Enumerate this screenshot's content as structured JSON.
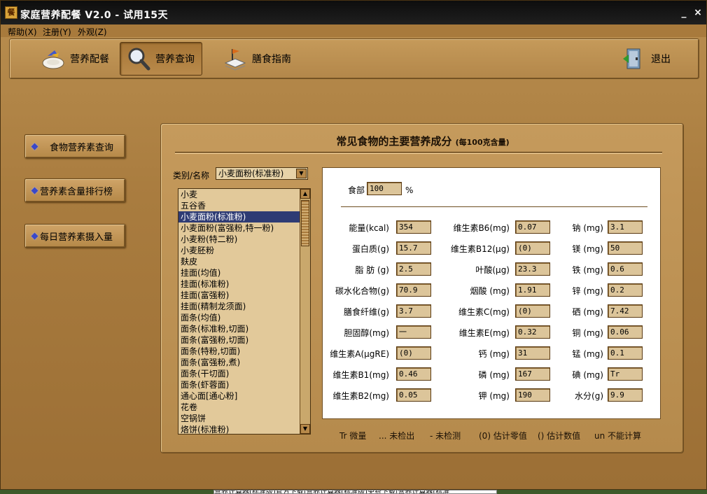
{
  "window": {
    "title": "家庭营养配餐 V2.0 - 试用15天",
    "app_icon": "餐",
    "minimize": "_",
    "close": "×"
  },
  "menu": [
    "帮助(X)",
    "注册(Y)",
    "外观(Z)"
  ],
  "toolbar": {
    "buttons": [
      {
        "label": "营养配餐",
        "icon": "meal-plate-icon"
      },
      {
        "label": "营养查询",
        "icon": "magnifier-icon"
      },
      {
        "label": "膳食指南",
        "icon": "book-flag-icon"
      }
    ],
    "exit": {
      "label": "退出",
      "icon": "exit-door-icon"
    },
    "active_index": 1
  },
  "sidebar": {
    "items": [
      "食物营养素查询",
      "营养素含量排行榜",
      "每日营养素摄入量"
    ]
  },
  "panel": {
    "title": "常见食物的主要营养成分",
    "subtitle": "(每100克含量)"
  },
  "category": {
    "label": "类别/名称",
    "selected": "小麦面粉(标准粉)"
  },
  "food_list": {
    "selected_index": 2,
    "items": [
      "小麦",
      "五谷香",
      "小麦面粉(标准粉)",
      "小麦面粉(富强粉,特一粉)",
      "小麦粉(特二粉)",
      "小麦胚粉",
      "麸皮",
      "挂面(均值)",
      "挂面(标准粉)",
      "挂面(富强粉)",
      "挂面(精制龙须面)",
      "面条(均值)",
      "面条(标准粉,切面)",
      "面条(富强粉,切面)",
      "面条(特粉,切面)",
      "面条(富强粉,煮)",
      "面条(干切面)",
      "面条(虾蓉面)",
      "通心面[通心粉]",
      "花卷",
      "空锅饼",
      "烙饼(标准粉)"
    ]
  },
  "edible": {
    "label": "食部",
    "value": "100",
    "unit": "%"
  },
  "nutrients": {
    "col1": [
      {
        "label": "能量(kcal)",
        "value": "354"
      },
      {
        "label": "蛋白质(g)",
        "value": "15.7"
      },
      {
        "label": "脂 肪 (g)",
        "value": "2.5"
      },
      {
        "label": "碳水化合物(g)",
        "value": "70.9"
      },
      {
        "label": "膳食纤维(g)",
        "value": "3.7"
      },
      {
        "label": "胆固醇(mg)",
        "value": "一"
      },
      {
        "label": "维生素A(μgRE)",
        "value": "(0)"
      },
      {
        "label": "维生素B1(mg)",
        "value": "0.46"
      },
      {
        "label": "维生素B2(mg)",
        "value": "0.05"
      }
    ],
    "col2": [
      {
        "label": "维生素B6(mg)",
        "value": "0.07"
      },
      {
        "label": "维生素B12(μg)",
        "value": "(0)"
      },
      {
        "label": "叶酸(μg)",
        "value": "23.3"
      },
      {
        "label": "烟酸 (mg)",
        "value": "1.91"
      },
      {
        "label": "维生素C(mg)",
        "value": "(0)"
      },
      {
        "label": "维生素E(mg)",
        "value": "0.32"
      },
      {
        "label": "钙 (mg)",
        "value": "31"
      },
      {
        "label": "磷 (mg)",
        "value": "167"
      },
      {
        "label": "钾 (mg)",
        "value": "190"
      }
    ],
    "col3": [
      {
        "label": "钠 (mg)",
        "value": "3.1"
      },
      {
        "label": "镁 (mg)",
        "value": "50"
      },
      {
        "label": "铁 (mg)",
        "value": "0.6"
      },
      {
        "label": "锌 (mg)",
        "value": "0.2"
      },
      {
        "label": "硒 (mg)",
        "value": "7.42"
      },
      {
        "label": "铜 (mg)",
        "value": "0.06"
      },
      {
        "label": "锰 (mg)",
        "value": "0.1"
      },
      {
        "label": "碘 (mg)",
        "value": "Tr"
      },
      {
        "label": "水分(g)",
        "value": "9.9"
      }
    ]
  },
  "legend": [
    "Tr 微量",
    "... 未检出",
    "- 未检测",
    "(0) 估计零值",
    "() 估计数值",
    "un 不能计算"
  ],
  "taskbar_text": "营养计算器(标准版)官方下载|营养计算器(标准版)免费下载|营养计算器(标准"
}
